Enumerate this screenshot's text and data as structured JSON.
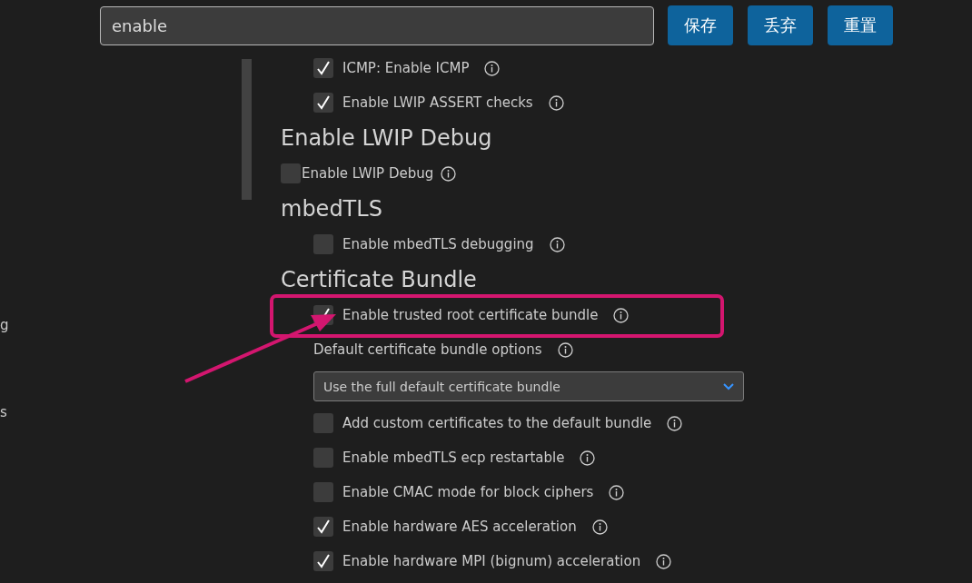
{
  "search": {
    "value": "enable"
  },
  "buttons": [
    "保存",
    "丢弃",
    "重置"
  ],
  "sidebar": {
    "items": [
      {
        "label": "g"
      },
      {
        "label": "s"
      }
    ]
  },
  "content": [
    {
      "kind": "checkbox",
      "label": "ICMP: Enable ICMP",
      "checked": true,
      "indented": true
    },
    {
      "kind": "checkbox",
      "label": "Enable LWIP ASSERT checks",
      "checked": true,
      "indented": true
    },
    {
      "kind": "heading",
      "label": "Enable LWIP Debug"
    },
    {
      "kind": "checkbox",
      "label": "Enable LWIP Debug",
      "checked": false,
      "indented": false
    },
    {
      "kind": "heading",
      "label": "mbedTLS"
    },
    {
      "kind": "checkbox",
      "label": "Enable mbedTLS debugging",
      "checked": false,
      "indented": true
    },
    {
      "kind": "heading",
      "label": "Certificate Bundle"
    },
    {
      "kind": "checkbox",
      "label": "Enable trusted root certificate bundle",
      "checked": true,
      "indented": true
    },
    {
      "kind": "label",
      "label": "Default certificate bundle options"
    },
    {
      "kind": "select",
      "value": "Use the full default certificate bundle"
    },
    {
      "kind": "checkbox",
      "label": "Add custom certificates to the default bundle",
      "checked": false,
      "indented": true
    },
    {
      "kind": "checkbox",
      "label": "Enable mbedTLS ecp restartable",
      "checked": false,
      "indented": true
    },
    {
      "kind": "checkbox",
      "label": "Enable CMAC mode for block ciphers",
      "checked": false,
      "indented": true
    },
    {
      "kind": "checkbox",
      "label": "Enable hardware AES acceleration",
      "checked": true,
      "indented": true
    },
    {
      "kind": "checkbox",
      "label": "Enable hardware MPI (bignum) acceleration",
      "checked": true,
      "indented": true
    }
  ]
}
